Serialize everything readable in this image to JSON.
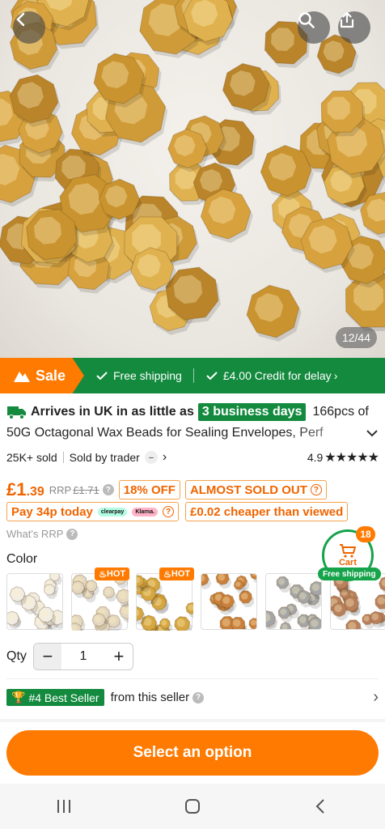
{
  "gallery": {
    "counter": "12/44"
  },
  "sale_bar": {
    "sale_label": "Sale",
    "free_shipping": "Free shipping",
    "credit": "£4.00 Credit for delay"
  },
  "title": {
    "arrival_prefix": "Arrives in UK in as little as",
    "arrival_days": "3 business days",
    "line1_rest": "166pcs of",
    "line2": "50G Octagonal Wax Beads for Sealing Envelopes, Perf"
  },
  "meta": {
    "sold": "25K+ sold",
    "seller": "Sold by trader",
    "rating": "4.9",
    "stars": "★★★★★"
  },
  "price": {
    "symbol": "£",
    "main": "1",
    "decimals": ".39",
    "rrp_label": "RRP",
    "rrp_value": "£1.71",
    "discount": "18% OFF",
    "stock": "ALMOST SOLD OUT"
  },
  "pay": {
    "pay_today": "Pay 34p today",
    "clearpay": "clearpay",
    "klarna": "Klarna.",
    "cheaper": "£0.02 cheaper than viewed"
  },
  "rrp_link": "What's RRP",
  "color": {
    "label": "Color",
    "hot_label": "HOT"
  },
  "cart": {
    "count": "18",
    "label": "Cart",
    "free_shipping": "Free shipping"
  },
  "qty": {
    "label": "Qty",
    "value": "1"
  },
  "best_seller": {
    "badge": "#4 Best Seller",
    "text": "from this seller"
  },
  "cta": {
    "label": "Select an option"
  },
  "colors": {
    "accent": "#ff7a00",
    "green": "#138a3e",
    "price": "#f06400"
  }
}
